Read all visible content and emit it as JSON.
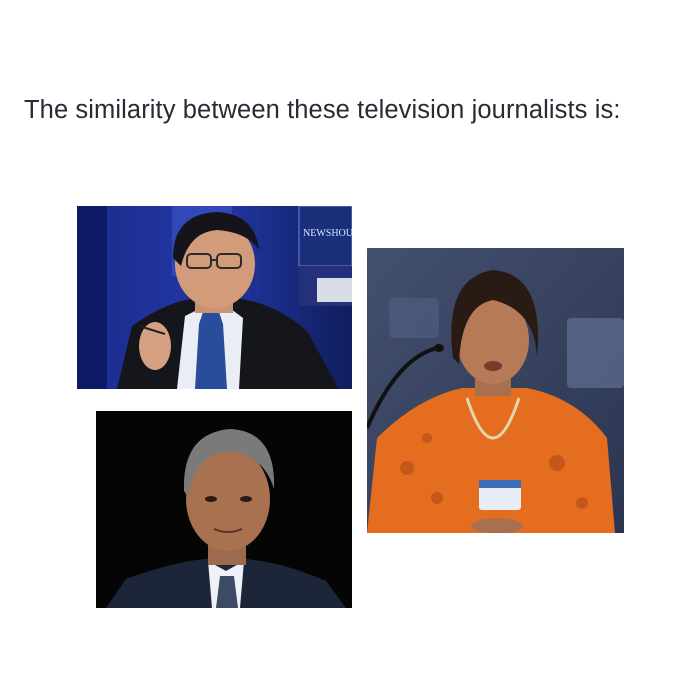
{
  "question": {
    "text": "The similarity between these television journalists is:"
  },
  "photos": [
    {
      "subject": "man in dark suit and blue tie with glasses in a news studio",
      "overlay_text": "THE NEWSHOUR"
    },
    {
      "subject": "man in dark suit with grey hair on black background"
    },
    {
      "subject": "woman in orange kurta with conference badge speaking at a microphone"
    }
  ],
  "colors": {
    "question_text": "#2a2a35",
    "background": "#ffffff"
  }
}
